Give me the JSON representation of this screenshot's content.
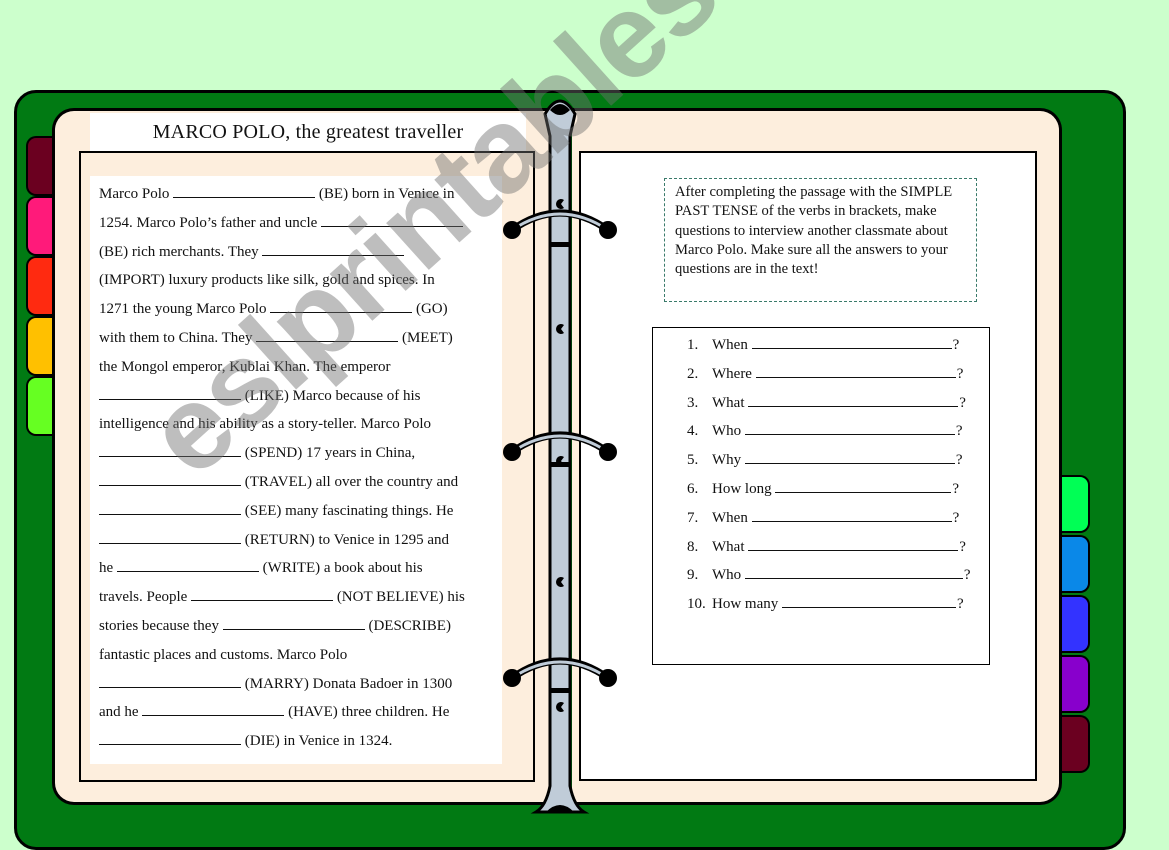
{
  "worksheet": {
    "title": "MARCO POLO, the greatest traveller",
    "passage_lines": [
      {
        "before": "Marco Polo ",
        "blank": 142,
        "after": " (BE) born in Venice in"
      },
      {
        "before": "1254. Marco Polo’s father and uncle ",
        "blank": 142,
        "after": ""
      },
      {
        "before": "(BE) rich merchants. They ",
        "blank": 142,
        "after": ""
      },
      {
        "before": "(IMPORT) luxury products like silk, gold and spices. In",
        "blank": 0,
        "after": ""
      },
      {
        "before": "1271 the young Marco Polo ",
        "blank": 142,
        "after": " (GO)"
      },
      {
        "before": "with them to China. They ",
        "blank": 142,
        "after": " (MEET)"
      },
      {
        "before": "the Mongol emperor, Kublai Khan. The emperor",
        "blank": 0,
        "after": ""
      },
      {
        "before": "",
        "blank": 142,
        "after": " (LIKE) Marco because of his"
      },
      {
        "before": "intelligence and his ability as a story-teller. Marco Polo",
        "blank": 0,
        "after": ""
      },
      {
        "before": "",
        "blank": 142,
        "after": " (SPEND) 17 years in China,"
      },
      {
        "before": "",
        "blank": 142,
        "after": " (TRAVEL) all over the country and"
      },
      {
        "before": "",
        "blank": 142,
        "after": " (SEE) many fascinating things. He"
      },
      {
        "before": "",
        "blank": 142,
        "after": " (RETURN) to Venice in 1295 and"
      },
      {
        "before": "he ",
        "blank": 142,
        "after": " (WRITE) a book about his"
      },
      {
        "before": "travels. People ",
        "blank": 142,
        "after": " (NOT BELIEVE) his"
      },
      {
        "before": "stories because they ",
        "blank": 142,
        "after": " (DESCRIBE)"
      },
      {
        "before": "fantastic places and customs. Marco Polo",
        "blank": 0,
        "after": ""
      },
      {
        "before": "",
        "blank": 142,
        "after": " (MARRY) Donata Badoer in 1300"
      },
      {
        "before": "and he ",
        "blank": 142,
        "after": " (HAVE) three children. He"
      },
      {
        "before": "",
        "blank": 142,
        "after": " (DIE) in Venice in 1324."
      }
    ],
    "instructions": "After completing the passage with the SIMPLE PAST TENSE of the verbs in brackets, make questions to interview another classmate about Marco Polo. Make sure all the answers to your questions are in the text!",
    "questions": [
      {
        "num": "1.",
        "word": "When"
      },
      {
        "num": "2.",
        "word": "Where"
      },
      {
        "num": "3.",
        "word": "What"
      },
      {
        "num": "4.",
        "word": "Who"
      },
      {
        "num": "5.",
        "word": "Why"
      },
      {
        "num": "6.",
        "word": "How long"
      },
      {
        "num": "7.",
        "word": "When"
      },
      {
        "num": "8.",
        "word": "What"
      },
      {
        "num": "9.",
        "word": "Who"
      },
      {
        "num": "10.",
        "word": "How many"
      }
    ],
    "question_mark": "?",
    "watermark": "eslprintables.com"
  },
  "colors": {
    "background": "#ccffcc",
    "binder_cover": "#017a13",
    "page": "#fdeedd",
    "spine": "#c0ccd8",
    "left_tabs": [
      "#6b0020",
      "#ff1a7a",
      "#ff2a10",
      "#ffc000",
      "#66ff22"
    ],
    "right_tabs": [
      "#00ff55",
      "#0a88e8",
      "#3333ff",
      "#8800cc",
      "#6b0020"
    ]
  }
}
